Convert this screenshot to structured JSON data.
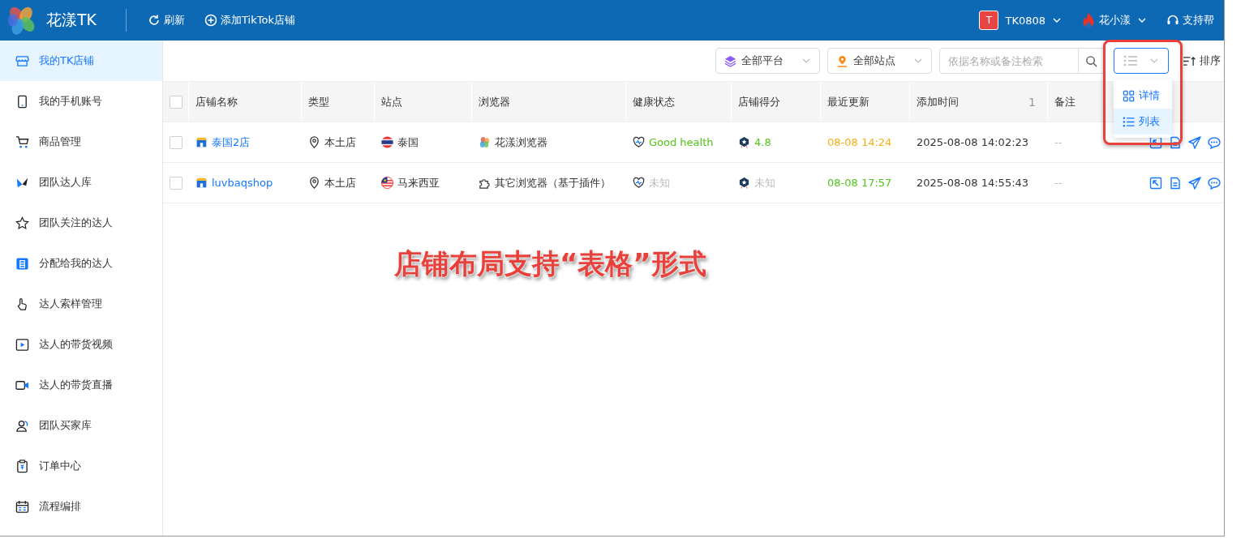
{
  "header": {
    "app_name": "花漾TK",
    "actions": [
      {
        "kind": "refresh",
        "label": "刷新"
      },
      {
        "kind": "add",
        "label": "添加TikTok店铺"
      }
    ],
    "account": {
      "avatar_letter": "T",
      "name": "TK0808"
    },
    "user": {
      "name": "花小漾"
    },
    "support": {
      "label": "支持帮"
    }
  },
  "sidebar": {
    "items": [
      {
        "label": "我的TK店铺",
        "selected": true
      },
      {
        "label": "我的手机账号",
        "selected": false
      },
      {
        "label": "商品管理",
        "selected": false
      },
      {
        "label": "团队达人库",
        "selected": false
      },
      {
        "label": "团队关注的达人",
        "selected": false
      },
      {
        "label": "分配给我的达人",
        "selected": false
      },
      {
        "label": "达人索样管理",
        "selected": false
      },
      {
        "label": "达人的带货视频",
        "selected": false
      },
      {
        "label": "达人的带货直播",
        "selected": false
      },
      {
        "label": "团队买家库",
        "selected": false
      },
      {
        "label": "订单中心",
        "selected": false
      },
      {
        "label": "流程编排",
        "selected": false
      }
    ]
  },
  "toolbar": {
    "platform_select": "全部平台",
    "site_select": "全部站点",
    "search": {
      "placeholder": "依据名称或备注检索"
    },
    "sort_button": "排序"
  },
  "view_menu": {
    "items": [
      {
        "label": "详情",
        "selected": false
      },
      {
        "label": "列表",
        "selected": true
      }
    ]
  },
  "table": {
    "all_checked": false,
    "columns": [
      "店铺名称",
      "类型",
      "站点",
      "浏览器",
      "健康状态",
      "店铺得分",
      "最近更新",
      "添加时间",
      "备注"
    ],
    "sort_badge": "1",
    "rows": [
      {
        "checked": false,
        "name": "泰国2店",
        "type": "本土店",
        "site": "泰国",
        "browser": {
          "kind": "huayang",
          "label": "花漾浏览器"
        },
        "health": {
          "known": true,
          "label": "Good health"
        },
        "score": {
          "known": true,
          "label": "4.8"
        },
        "updated": {
          "label": "08-08 14:24",
          "color": "#faad14"
        },
        "added": "2025-08-08 14:02:23",
        "note": "--"
      },
      {
        "checked": false,
        "name": "luvbaqshop",
        "type": "本土店",
        "site": "马来西亚",
        "browser": {
          "kind": "plugin",
          "label": "其它浏览器（基于插件）"
        },
        "health": {
          "known": false,
          "label": "未知"
        },
        "score": {
          "known": false,
          "label": "未知"
        },
        "updated": {
          "label": "08-08 17:57",
          "color": "#52c41a"
        },
        "added": "2025-08-08 14:55:43",
        "note": "--"
      }
    ]
  },
  "annotation": "店铺布局支持“表格”形式"
}
